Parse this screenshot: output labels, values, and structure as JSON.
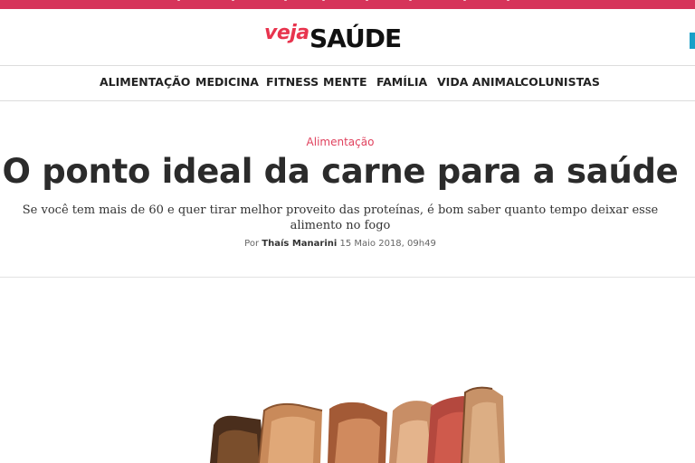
{
  "header": {
    "logo_veja": "veja",
    "logo_saude": "SAÚDE"
  },
  "nav": {
    "items": [
      {
        "label": "ALIMENTAÇÃO"
      },
      {
        "label": "MEDICINA"
      },
      {
        "label": "FITNESS"
      },
      {
        "label": "MENTE"
      },
      {
        "label": "FAMÍLIA"
      },
      {
        "label": "VIDA ANIMAL"
      },
      {
        "label": "COLUNISTAS"
      }
    ]
  },
  "article": {
    "category": "Alimentação",
    "headline": "O ponto ideal da carne para a saúde",
    "subtitle": "Se você tem mais de 60 e quer tirar melhor proveito das proteínas, é bom saber quanto tempo deixar esse alimento no fogo",
    "byline_prefix": "Por",
    "author": "Thaís Manarini",
    "date": "15 Maio 2018, 09h49"
  },
  "colors": {
    "brand_pink": "#d6345a",
    "category_red": "#e0425e",
    "logo_red": "#e8344e"
  },
  "icons": {
    "image": "sliced-meat-photo"
  }
}
